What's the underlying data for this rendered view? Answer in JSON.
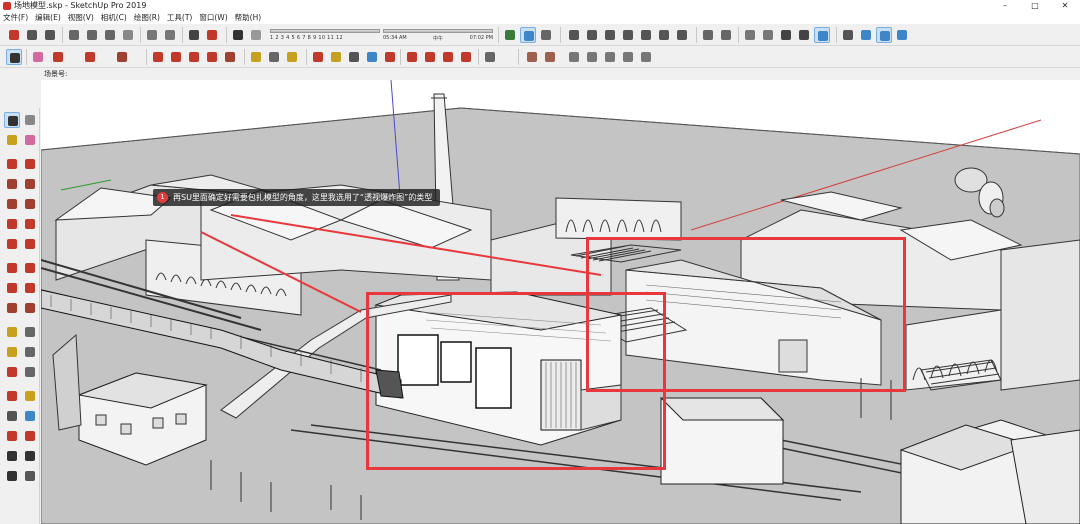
{
  "window": {
    "title": "场地模型.skp - SketchUp Pro 2019",
    "controls": [
      "–",
      "□",
      "✕"
    ]
  },
  "menu": [
    "文件(F)",
    "编辑(E)",
    "视图(V)",
    "相机(C)",
    "绘图(R)",
    "工具(T)",
    "窗口(W)",
    "帮助(H)"
  ],
  "shadow_months": "1 2 3 4 5 6 7 8 9 10 11 12",
  "time": {
    "start": "05:34 AM",
    "mid": "中午",
    "end": "07:02 PM"
  },
  "scene_tab": "场景号:",
  "annotation": {
    "number": "1",
    "text": "再SU里面确定好需要包扎模型的角度，这里我选用了“透视爆炸图”的类型"
  },
  "colors": {
    "highlight": "#e8383d",
    "ground": "#c4c4c4",
    "active_tool": "#c9e0f7"
  },
  "icons": {
    "toolbar_top": [
      "save-icon",
      "cut-icon",
      "copy-icon",
      "paste-icon",
      "erase-icon",
      "undo-icon",
      "redo-icon",
      "print-icon",
      "model-info-icon",
      "shadow-icon",
      "fog-icon",
      "section-icon",
      "xray-icon",
      "wireframe-icon",
      "hidden-line-icon",
      "shaded-icon",
      "textured-icon",
      "monochrome-icon",
      "iso-view-icon",
      "top-view-icon",
      "front-view-icon",
      "right-view-icon",
      "back-view-icon",
      "left-view-icon",
      "orbit-icon",
      "pan-icon",
      "zoom-icon",
      "zoom-extents-icon"
    ],
    "toolbar_second": [
      "select-icon",
      "eraser-icon",
      "pencil-icon",
      "arc-icon",
      "rectangle-icon",
      "push-pull-icon",
      "move-icon",
      "rotate-icon",
      "scale-icon",
      "offset-icon",
      "tape-measure-icon",
      "text-icon",
      "paint-bucket-icon",
      "orbit-icon",
      "pan-icon",
      "zoom-icon",
      "zoom-window-icon",
      "zoom-extents-icon",
      "previous-view-icon",
      "position-camera-icon",
      "walk-icon",
      "look-around-icon",
      "section-plane-icon",
      "user-icon",
      "sandbox-icon"
    ]
  }
}
